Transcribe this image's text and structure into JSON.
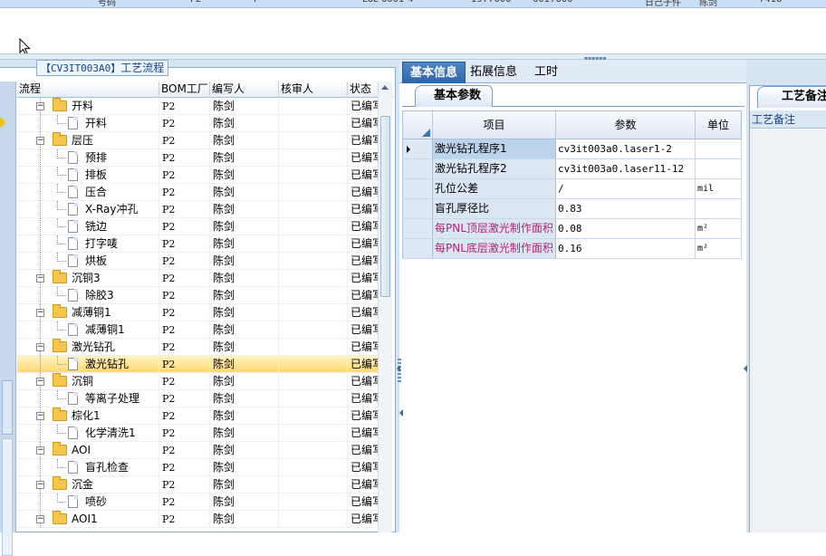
{
  "top_strip": {
    "fragments": [
      "号码",
      "P2",
      "P",
      "L6L-6001-4",
      "1977000",
      "6017000",
      "日己子件",
      "陈剑",
      "7418"
    ]
  },
  "left": {
    "title_code": "【CV3IT003A0】",
    "title_text": "工艺流程",
    "columns": [
      "流程",
      "BOM工厂",
      "编写人",
      "核审人",
      "状态"
    ],
    "rows": [
      {
        "name": "开料",
        "level": 1,
        "type": "folder",
        "plant": "P2",
        "writer": "陈剑",
        "reviewer": "",
        "status": "已编写"
      },
      {
        "name": "开料",
        "level": 2,
        "type": "doc",
        "plant": "P2",
        "writer": "陈剑",
        "reviewer": "",
        "status": "已编写"
      },
      {
        "name": "层压",
        "level": 1,
        "type": "folder",
        "plant": "P2",
        "writer": "陈剑",
        "reviewer": "",
        "status": "已编写"
      },
      {
        "name": "预排",
        "level": 2,
        "type": "doc",
        "plant": "P2",
        "writer": "陈剑",
        "reviewer": "",
        "status": "已编写"
      },
      {
        "name": "排板",
        "level": 2,
        "type": "doc",
        "plant": "P2",
        "writer": "陈剑",
        "reviewer": "",
        "status": "已编写"
      },
      {
        "name": "压合",
        "level": 2,
        "type": "doc",
        "plant": "P2",
        "writer": "陈剑",
        "reviewer": "",
        "status": "已编写"
      },
      {
        "name": "X-Ray冲孔",
        "level": 2,
        "type": "doc",
        "plant": "P2",
        "writer": "陈剑",
        "reviewer": "",
        "status": "已编写"
      },
      {
        "name": "铣边",
        "level": 2,
        "type": "doc",
        "plant": "P2",
        "writer": "陈剑",
        "reviewer": "",
        "status": "已编写"
      },
      {
        "name": "打字唛",
        "level": 2,
        "type": "doc",
        "plant": "P2",
        "writer": "陈剑",
        "reviewer": "",
        "status": "已编写"
      },
      {
        "name": "烘板",
        "level": 2,
        "type": "doc",
        "plant": "P2",
        "writer": "陈剑",
        "reviewer": "",
        "status": "已编写"
      },
      {
        "name": "沉铜3",
        "level": 1,
        "type": "folder",
        "plant": "P2",
        "writer": "陈剑",
        "reviewer": "",
        "status": "已编写"
      },
      {
        "name": "除胶3",
        "level": 2,
        "type": "doc",
        "plant": "P2",
        "writer": "陈剑",
        "reviewer": "",
        "status": "已编写"
      },
      {
        "name": "减薄铜1",
        "level": 1,
        "type": "folder",
        "plant": "P2",
        "writer": "陈剑",
        "reviewer": "",
        "status": "已编写"
      },
      {
        "name": "减薄铜1",
        "level": 2,
        "type": "doc",
        "plant": "P2",
        "writer": "陈剑",
        "reviewer": "",
        "status": "已编写"
      },
      {
        "name": "激光钻孔",
        "level": 1,
        "type": "folder",
        "plant": "P2",
        "writer": "陈剑",
        "reviewer": "",
        "status": "已编写"
      },
      {
        "name": "激光钻孔",
        "level": 2,
        "type": "doc",
        "plant": "P2",
        "writer": "陈剑",
        "reviewer": "",
        "status": "已编写",
        "selected": true
      },
      {
        "name": "沉铜",
        "level": 1,
        "type": "folder",
        "plant": "P2",
        "writer": "陈剑",
        "reviewer": "",
        "status": "已编写"
      },
      {
        "name": "等离子处理",
        "level": 2,
        "type": "doc",
        "plant": "P2",
        "writer": "陈剑",
        "reviewer": "",
        "status": "已编写"
      },
      {
        "name": "棕化1",
        "level": 1,
        "type": "folder",
        "plant": "P2",
        "writer": "陈剑",
        "reviewer": "",
        "status": "已编写"
      },
      {
        "name": "化学清洗1",
        "level": 2,
        "type": "doc",
        "plant": "P2",
        "writer": "陈剑",
        "reviewer": "",
        "status": "已编写"
      },
      {
        "name": "AOI",
        "level": 1,
        "type": "folder",
        "plant": "P2",
        "writer": "陈剑",
        "reviewer": "",
        "status": "已编写"
      },
      {
        "name": "盲孔检查",
        "level": 2,
        "type": "doc",
        "plant": "P2",
        "writer": "陈剑",
        "reviewer": "",
        "status": "已编写"
      },
      {
        "name": "沉金",
        "level": 1,
        "type": "folder",
        "plant": "P2",
        "writer": "陈剑",
        "reviewer": "",
        "status": "已编写"
      },
      {
        "name": "喷砂",
        "level": 2,
        "type": "doc",
        "plant": "P2",
        "writer": "陈剑",
        "reviewer": "",
        "status": "已编写"
      },
      {
        "name": "AOI1",
        "level": 1,
        "type": "folder",
        "plant": "P2",
        "writer": "陈剑",
        "reviewer": "",
        "status": "已编写"
      }
    ]
  },
  "middle": {
    "tabs": [
      {
        "label": "基本信息",
        "active": true
      },
      {
        "label": "拓展信息",
        "active": false
      },
      {
        "label": "工时",
        "active": false
      }
    ],
    "subtab": "基本参数",
    "columns": [
      "项目",
      "参数",
      "单位"
    ],
    "rows": [
      {
        "item": "激光钻孔程序1",
        "value": "cv3it003a0.laser1-2",
        "unit": "",
        "highlight": false,
        "current": true
      },
      {
        "item": "激光钻孔程序2",
        "value": "cv3it003a0.laser11-12",
        "unit": "",
        "highlight": false,
        "current": false
      },
      {
        "item": "孔位公差",
        "value": "/",
        "unit": "mil",
        "highlight": false,
        "current": false
      },
      {
        "item": "盲孔厚径比",
        "value": "0.83",
        "unit": "",
        "highlight": false,
        "current": false
      },
      {
        "item": "每PNL顶层激光制作面积",
        "value": "0.08",
        "unit": "m²",
        "highlight": true,
        "current": false
      },
      {
        "item": "每PNL底层激光制作面积",
        "value": "0.16",
        "unit": "m²",
        "highlight": true,
        "current": false
      }
    ]
  },
  "right": {
    "tab": "工艺备注",
    "label": "工艺备注"
  },
  "colors": {
    "accent_tab": "#2d64aa",
    "selected_row": "#ffd873",
    "highlight_text": "#b0247a",
    "panel_border": "#8eaacd"
  }
}
